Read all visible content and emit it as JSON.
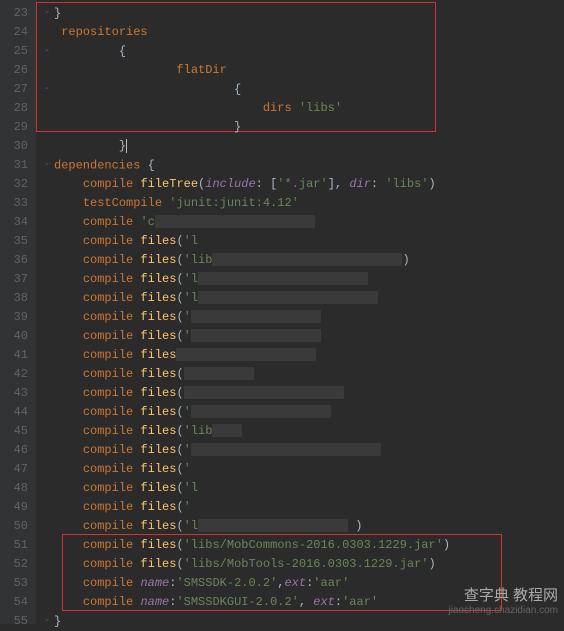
{
  "gutter": {
    "start": 23,
    "end": 55
  },
  "lines": {
    "l23": {
      "i": 0,
      "fold": "-",
      "punct": "}"
    },
    "l24": {
      "i": 1,
      "fold": "",
      "kw": "repositories"
    },
    "l25": {
      "i": 5,
      "fold": "-",
      "punct": "{"
    },
    "l26": {
      "i": 9,
      "fold": "",
      "kw": "flatDir"
    },
    "l27": {
      "i": 13,
      "fold": "-",
      "punct": "{"
    },
    "l28": {
      "i": 15,
      "fold": "",
      "kw": "dirs",
      "str": "'libs'"
    },
    "l29": {
      "i": 13,
      "fold": "",
      "punct": "}"
    },
    "l30": {
      "i": 5,
      "fold": "",
      "punct": "}"
    },
    "l31": {
      "i": 0,
      "fold": "-",
      "kw": "dependencies",
      "punct": " {"
    },
    "l32": {
      "i": 2,
      "fold": "",
      "kw": "compile",
      "fn": " fileTree",
      "p1": "(",
      "n1": "include",
      "p2": ": [",
      "s1": "'*.jar'",
      "p3": "], ",
      "n2": "dir",
      "p4": ": ",
      "s2": "'libs'",
      "p5": ")"
    },
    "l33": {
      "i": 2,
      "fold": "",
      "kw": "testCompile",
      "str": "'junit:junit:4.12'"
    },
    "l34": {
      "i": 2,
      "fold": "",
      "kw": "compile",
      "str": "'c",
      "ob": 160
    },
    "l35": {
      "i": 2,
      "fold": "",
      "kw": "compile",
      "fn": " files",
      "p1": "(",
      "s1": "'l",
      "ob": 0,
      "p2": ""
    },
    "l36": {
      "i": 2,
      "fold": "",
      "kw": "compile",
      "fn": " files",
      "p1": "(",
      "s1": "'lib",
      "ob": 190,
      "p2": ")"
    },
    "l37": {
      "i": 2,
      "fold": "",
      "kw": "compile",
      "fn": " files",
      "p1": "(",
      "s1": "'l",
      "ob": 170,
      "p2": ""
    },
    "l38": {
      "i": 2,
      "fold": "",
      "kw": "compile",
      "fn": " files",
      "p1": "(",
      "s1": "'l",
      "ob": 180,
      "p2": ""
    },
    "l39": {
      "i": 2,
      "fold": "",
      "kw": "compile",
      "fn": " files",
      "p1": "(",
      "s1": "'",
      "ob": 130,
      "p2": ""
    },
    "l40": {
      "i": 2,
      "fold": "",
      "kw": "compile",
      "fn": " files",
      "p1": "(",
      "s1": "'",
      "ob": 130,
      "p2": ""
    },
    "l41": {
      "i": 2,
      "fold": "",
      "kw": "compile",
      "fn": " files",
      "p1": "",
      "s1": "",
      "ob": 140,
      "p2": ""
    },
    "l42": {
      "i": 2,
      "fold": "",
      "kw": "compile",
      "fn": " files",
      "p1": "(",
      "s1": "",
      "ob": 70,
      "p2": ""
    },
    "l43": {
      "i": 2,
      "fold": "",
      "kw": "compile",
      "fn": " files",
      "p1": "(",
      "s1": "",
      "ob": 160,
      "p2": ""
    },
    "l44": {
      "i": 2,
      "fold": "",
      "kw": "compile",
      "fn": " files",
      "p1": "(",
      "s1": "'",
      "ob": 140,
      "p2": ""
    },
    "l45": {
      "i": 2,
      "fold": "",
      "kw": "compile",
      "fn": " files",
      "p1": "(",
      "s1": "'lib",
      "ob": 30,
      "p2": ""
    },
    "l46": {
      "i": 2,
      "fold": "",
      "kw": "compile",
      "fn": " files",
      "p1": "(",
      "s1": "'",
      "ob": 190,
      "p2": ""
    },
    "l47": {
      "i": 2,
      "fold": "",
      "kw": "compile",
      "fn": " files",
      "p1": "(",
      "s1": "'",
      "ob": 0,
      "p2": ""
    },
    "l48": {
      "i": 2,
      "fold": "",
      "kw": "compile",
      "fn": " files",
      "p1": "(",
      "s1": "'l",
      "ob": 0,
      "p2": ""
    },
    "l49": {
      "i": 2,
      "fold": "",
      "kw": "compile",
      "fn": " files",
      "p1": "(",
      "s1": "'",
      "ob": 0,
      "p2": ""
    },
    "l50": {
      "i": 2,
      "fold": "",
      "kw": "compile",
      "fn": " files",
      "p1": "(",
      "s1": "'l",
      "ob": 150,
      "p2": " )"
    },
    "l51": {
      "i": 2,
      "fold": "",
      "kw": "compile",
      "fn": " files",
      "p1": "(",
      "s1": "'libs/MobCommons-2016.0303.1229.jar'",
      "p2": ")"
    },
    "l52": {
      "i": 2,
      "fold": "",
      "kw": "compile",
      "fn": " files",
      "p1": "(",
      "s1": "'libs/MobTools-2016.0303.1229.jar'",
      "p2": ")"
    },
    "l53": {
      "i": 2,
      "fold": "",
      "kw": "compile",
      "n1": "name",
      "p1": ":",
      "s1": "'SMSSDK-2.0.2'",
      "p2": ",",
      "n2": "ext",
      "p3": ":",
      "s2": "'aar'"
    },
    "l54": {
      "i": 2,
      "fold": "",
      "kw": "compile",
      "n1": "name",
      "p1": ":",
      "s1": "'SMSSDKGUI-2.0.2'",
      "p2": ", ",
      "n2": "ext",
      "p3": ":",
      "s2": "'aar'"
    },
    "l55": {
      "i": 0,
      "fold": "-",
      "punct": "}"
    }
  },
  "watermark": {
    "line1": "查字典 教程网",
    "line2": "jiaocheng.chazidian.com"
  }
}
